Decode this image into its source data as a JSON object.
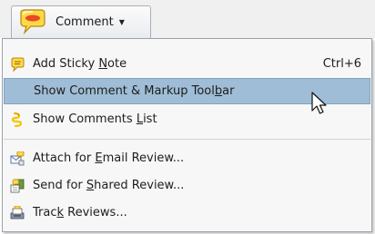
{
  "toolbar": {
    "button_label": "Comment",
    "button_icon": "speech-bubble-icon",
    "dropdown_icon": "triangle-down-icon"
  },
  "menu": {
    "items": [
      {
        "pre": "Add Sticky ",
        "mn": "N",
        "post": "ote",
        "shortcut": "Ctrl+6",
        "icon": "sticky-note-icon",
        "highlighted": false
      },
      {
        "pre": "Show Comment & Markup Tool",
        "mn": "b",
        "post": "ar",
        "shortcut": "",
        "icon": "",
        "highlighted": true
      },
      {
        "pre": "Show Comments ",
        "mn": "L",
        "post": "ist",
        "shortcut": "",
        "icon": "comments-list-icon",
        "highlighted": false
      },
      {
        "pre": "Attach for ",
        "mn": "E",
        "post": "mail Review...",
        "shortcut": "",
        "icon": "email-review-icon",
        "highlighted": false
      },
      {
        "pre": "Send for ",
        "mn": "S",
        "post": "hared Review...",
        "shortcut": "",
        "icon": "shared-review-icon",
        "highlighted": false
      },
      {
        "pre": "Trac",
        "mn": "k",
        "post": " Reviews...",
        "shortcut": "",
        "icon": "track-reviews-icon",
        "highlighted": false
      }
    ]
  },
  "colors": {
    "highlight": "#9fbdd6",
    "menu_background": "#f7f7f7",
    "icon_yellow": "#f5c400"
  }
}
